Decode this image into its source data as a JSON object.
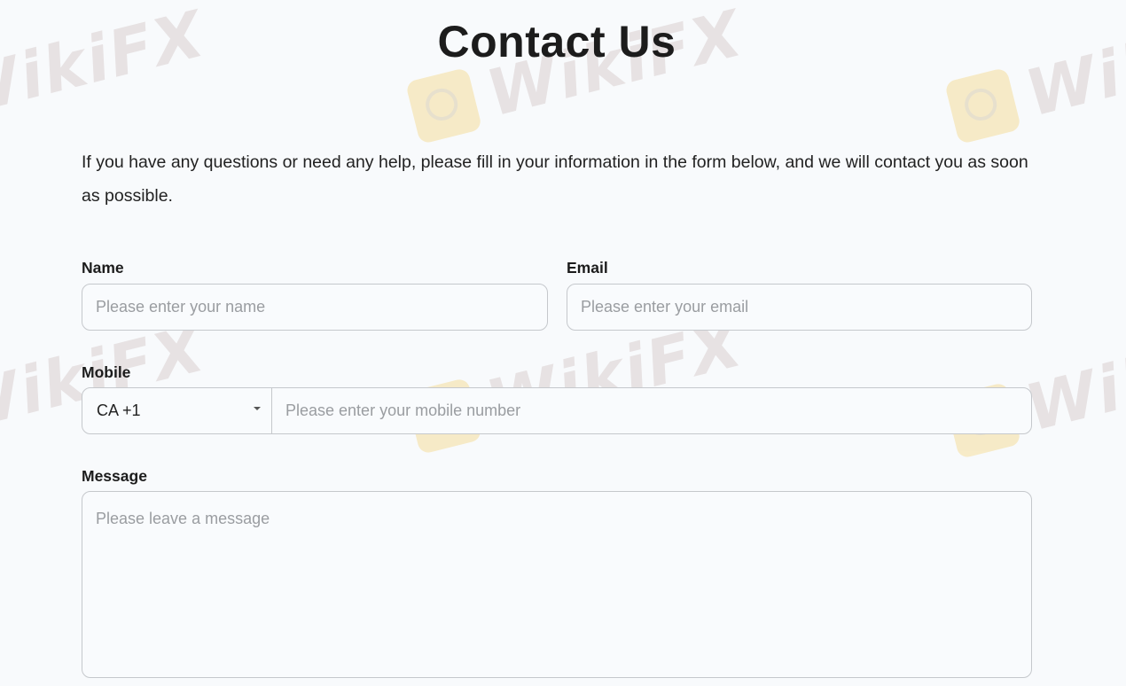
{
  "page": {
    "title": "Contact Us",
    "intro": "If you have any questions or need any help, please fill in your information in the form below, and we will contact you as soon as possible."
  },
  "form": {
    "name": {
      "label": "Name",
      "placeholder": "Please enter your name",
      "value": ""
    },
    "email": {
      "label": "Email",
      "placeholder": "Please enter your email",
      "value": ""
    },
    "mobile": {
      "label": "Mobile",
      "country_code": "CA +1",
      "placeholder": "Please enter your mobile number",
      "value": ""
    },
    "message": {
      "label": "Message",
      "placeholder": "Please leave a message",
      "value": ""
    }
  },
  "watermark": {
    "text": "WikiFX",
    "logo_color": "#f6dc94",
    "text_color": "#d7cccc"
  },
  "colors": {
    "background": "#f8fafc",
    "border": "#c5c8cc",
    "placeholder": "#9a9da1",
    "text": "#1c1c1c"
  }
}
